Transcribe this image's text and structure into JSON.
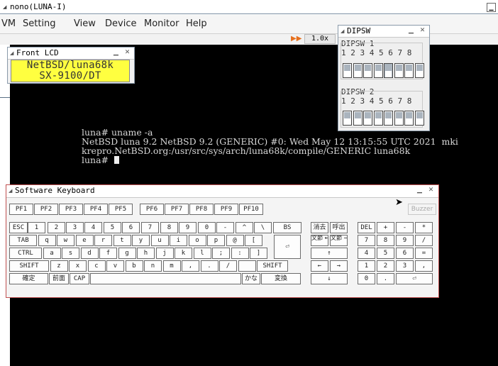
{
  "main_window": {
    "title": "nono(LUNA-I)"
  },
  "menubar": [
    "VM",
    "Setting",
    "View",
    "Device",
    "Monitor",
    "Help"
  ],
  "toolbar": {
    "speed": "1.0x"
  },
  "terminal": {
    "lines": [
      "luna# uname -a",
      "NetBSD luna 9.2 NetBSD 9.2 (GENERIC) #0: Wed May 12 13:15:55 UTC 2021  mki",
      "krepro.NetBSD.org:/usr/src/sys/arch/luna68k/compile/GENERIC luna68k",
      "luna# "
    ]
  },
  "front_lcd": {
    "title": "Front LCD",
    "line1": "NetBSD/luna68k",
    "line2": "SX-9100/DT",
    "bg_color": "#ffff40"
  },
  "dipsw": {
    "title": "DIPSW",
    "groups": [
      {
        "label": "DIPSW 1",
        "numbers": "1 2 3 4 5 6 7 8",
        "states": [
          "up",
          "up",
          "up",
          "up",
          "down",
          "up",
          "up",
          "up"
        ]
      },
      {
        "label": "DIPSW 2",
        "numbers": "1 2 3 4 5 6 7 8",
        "states": [
          "up",
          "up",
          "up",
          "up",
          "up",
          "up",
          "up",
          "up"
        ]
      }
    ]
  },
  "keyboard": {
    "title": "Software Keyboard",
    "buzzer": "Buzzer",
    "fkeys": [
      "PF1",
      "PF2",
      "PF3",
      "PF4",
      "PF5",
      "PF6",
      "PF7",
      "PF8",
      "PF9",
      "PF10"
    ],
    "row1": [
      "ESC",
      "1",
      "2",
      "3",
      "4",
      "5",
      "6",
      "7",
      "8",
      "9",
      "0",
      "-",
      "^",
      "\\",
      "BS"
    ],
    "row2": [
      "TAB",
      "q",
      "w",
      "e",
      "r",
      "t",
      "y",
      "u",
      "i",
      "o",
      "p",
      "@",
      "["
    ],
    "row3": [
      "CTRL",
      "a",
      "s",
      "d",
      "f",
      "g",
      "h",
      "j",
      "k",
      "l",
      ";",
      ":",
      "]"
    ],
    "row4": [
      "SHIFT",
      "z",
      "x",
      "c",
      "v",
      "b",
      "n",
      "m",
      ",",
      ".",
      "/",
      "",
      "SHIFT"
    ],
    "row5": [
      "確定",
      "前面",
      "CAP",
      "",
      "かな",
      "変換"
    ],
    "enter": "⏎",
    "edit": {
      "row1": [
        "消去",
        "呼出"
      ],
      "row2_a": "文節 ←",
      "row2_b": "文節 →",
      "up": "↑",
      "left": "←",
      "right": "→",
      "down": "↓"
    },
    "numpad": {
      "row1": [
        "DEL",
        "+",
        "-",
        "*"
      ],
      "row2": [
        "7",
        "8",
        "9",
        "/"
      ],
      "row3": [
        "4",
        "5",
        "6",
        "="
      ],
      "row4": [
        "1",
        "2",
        "3",
        ","
      ],
      "row5": [
        "0",
        ".",
        "⏎"
      ]
    }
  },
  "colors": {
    "screen_bg": "#000000",
    "terminal_text": "#d8d8d8",
    "keyboard_border": "#c05050",
    "fast_forward": "#e6701e"
  }
}
